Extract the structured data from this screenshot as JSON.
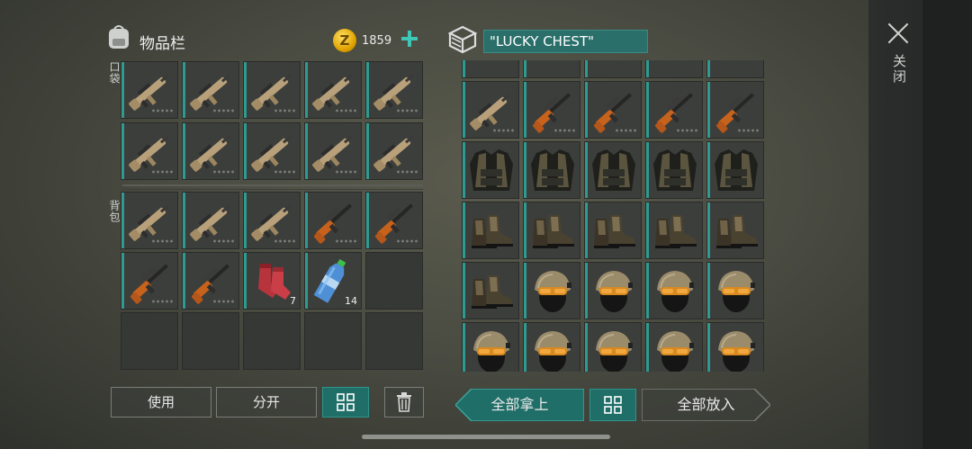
{
  "inventory": {
    "title": "物品栏",
    "coins": "1859",
    "pocket_label": "口袋",
    "backpack_label": "背包",
    "pocket": [
      {
        "item": "rifle-scar"
      },
      {
        "item": "rifle-scar"
      },
      {
        "item": "rifle-scar"
      },
      {
        "item": "rifle-scar"
      },
      {
        "item": "rifle-scar"
      },
      {
        "item": "rifle-scar"
      },
      {
        "item": "rifle-scar"
      },
      {
        "item": "rifle-scar"
      },
      {
        "item": "rifle-scar"
      },
      {
        "item": "rifle-scar"
      }
    ],
    "backpack": [
      {
        "item": "rifle-scar"
      },
      {
        "item": "rifle-scar"
      },
      {
        "item": "rifle-scar"
      },
      {
        "item": "rifle-svd"
      },
      {
        "item": "rifle-svd"
      },
      {
        "item": "rifle-svd"
      },
      {
        "item": "rifle-svd"
      },
      {
        "item": "socks",
        "qty": "7"
      },
      {
        "item": "water-bottle",
        "qty": "14"
      },
      {
        "item": ""
      },
      {
        "item": ""
      },
      {
        "item": ""
      },
      {
        "item": ""
      },
      {
        "item": ""
      },
      {
        "item": ""
      }
    ]
  },
  "chest": {
    "name": "\"LUCKY CHEST\"",
    "items": [
      {
        "item": "partial"
      },
      {
        "item": "partial"
      },
      {
        "item": "partial"
      },
      {
        "item": "partial"
      },
      {
        "item": "partial"
      },
      {
        "item": "rifle-scar"
      },
      {
        "item": "rifle-svd"
      },
      {
        "item": "rifle-svd"
      },
      {
        "item": "rifle-svd"
      },
      {
        "item": "rifle-svd"
      },
      {
        "item": "vest"
      },
      {
        "item": "vest"
      },
      {
        "item": "vest"
      },
      {
        "item": "vest"
      },
      {
        "item": "vest"
      },
      {
        "item": "boots"
      },
      {
        "item": "boots"
      },
      {
        "item": "boots"
      },
      {
        "item": "boots"
      },
      {
        "item": "boots"
      },
      {
        "item": "boots"
      },
      {
        "item": "helmet"
      },
      {
        "item": "helmet"
      },
      {
        "item": "helmet"
      },
      {
        "item": "helmet"
      },
      {
        "item": "helmet"
      },
      {
        "item": "helmet"
      },
      {
        "item": "helmet"
      },
      {
        "item": "helmet"
      },
      {
        "item": "helmet"
      }
    ]
  },
  "buttons": {
    "use": "使用",
    "split": "分开",
    "take_all": "全部拿上",
    "put_all": "全部放入"
  },
  "close_label": "关闭",
  "colors": {
    "accent": "#2f9a91",
    "teal_button": "#1f6e68",
    "coin": "#e0a400"
  }
}
